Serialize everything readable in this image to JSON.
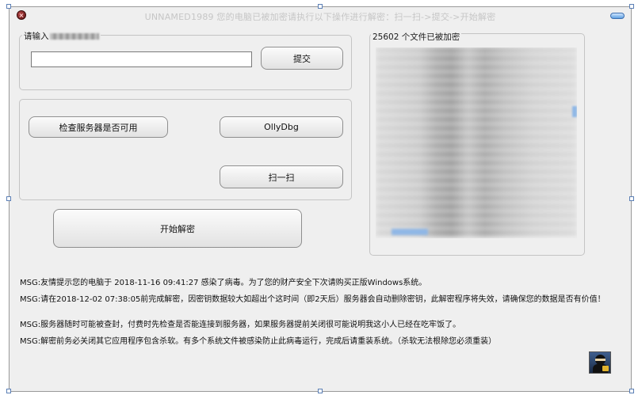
{
  "window": {
    "title": "UNNAMED1989 您的电脑已被加密请执行以下操作进行解密：扫一扫->提交->开始解密"
  },
  "input_group": {
    "label": "请输入",
    "field_value": "",
    "submit_label": "提交"
  },
  "tools": {
    "check_server_label": "检查服务器是否可用",
    "ollydbg_label": "OllyDbg",
    "scan_label": "扫一扫"
  },
  "decrypt_label": "开始解密",
  "files": {
    "label": "25602 个文件已被加密"
  },
  "messages": [
    "MSG:友情提示您的电脑于 2018-11-16 09:41:27  感染了病毒。为了您的财产安全下次请购买正版Windows系统。",
    "MSG:请在2018-12-02 07:38:05前完成解密，因密钥数据较大如超出个这时间（即2天后）服务器会自动删除密钥，此解密程序将失效，请确保您的数据是否有价值！",
    "MSG:服务器随时可能被查封，付费时先检查是否能连接到服务器，如果服务器提前关闭很可能说明我这小人已经在吃牢饭了。",
    "MSG:解密前务必关闭其它应用程序包含杀软。有多个系统文件被感染防止此病毒运行，完成后请重装系统。（杀软无法根除您必须重装）"
  ],
  "icons": {
    "close": "close-icon",
    "minimize": "minimize-icon",
    "avatar": "hacker-avatar-icon"
  },
  "colors": {
    "window_bg": "#efefef",
    "title_text": "#c6c6c6",
    "close_button": "#8b2020",
    "minimize_button": "#5e9fe0"
  }
}
